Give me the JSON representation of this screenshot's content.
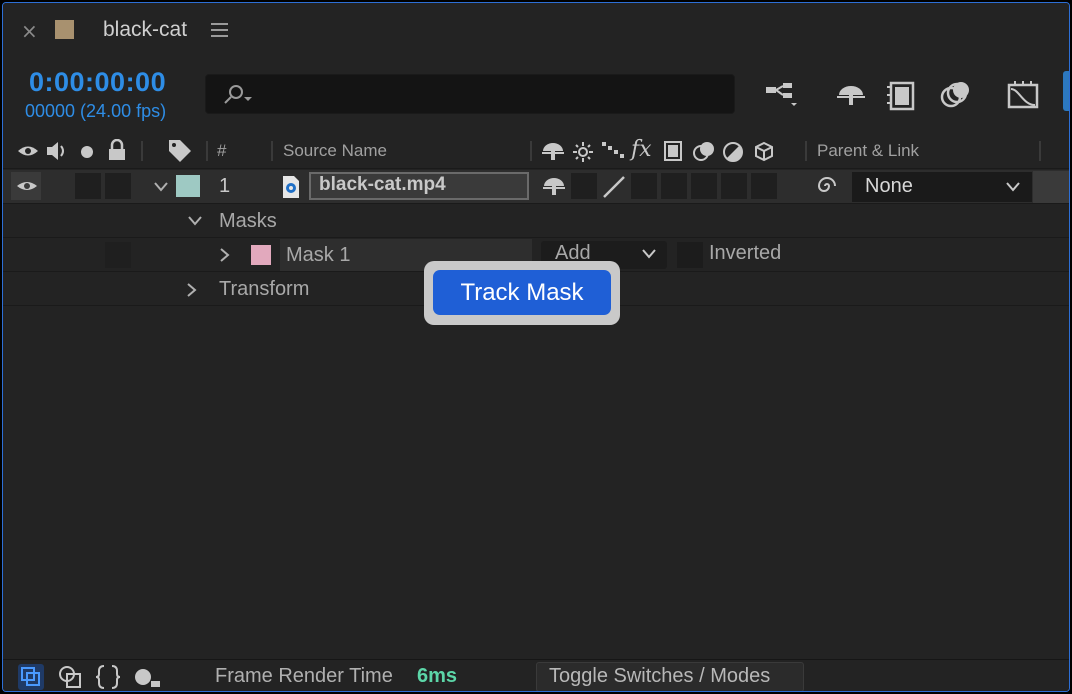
{
  "tab": {
    "close_label": "×",
    "title": "black-cat",
    "swatch_color": "#a8916f"
  },
  "time": {
    "timecode": "0:00:00:00",
    "frames": "00000 (24.00 fps)"
  },
  "search": {
    "placeholder": ""
  },
  "toolbar": {
    "icons": [
      "composition-flowchart-icon",
      "draft-3d-icon",
      "frame-blending-icon",
      "motion-blur-icon",
      "graph-editor-icon"
    ]
  },
  "headers": {
    "number": "#",
    "source_name": "Source Name",
    "fx": "fx",
    "parent_link": "Parent & Link"
  },
  "layer": {
    "number": "1",
    "name": "black-cat.mp4",
    "label_color": "#9ec9c3",
    "parent_value": "None"
  },
  "masks": {
    "group_label": "Masks",
    "mask_name": "Mask 1",
    "mask_color": "#e2a9bd",
    "mode": "Add",
    "inverted_label": "Inverted"
  },
  "transform": {
    "label": "Transform"
  },
  "tooltip": {
    "label": "Track Mask"
  },
  "footer": {
    "render_label": "Frame Render Time",
    "render_value": "6ms",
    "toggle_label": "Toggle Switches / Modes"
  }
}
